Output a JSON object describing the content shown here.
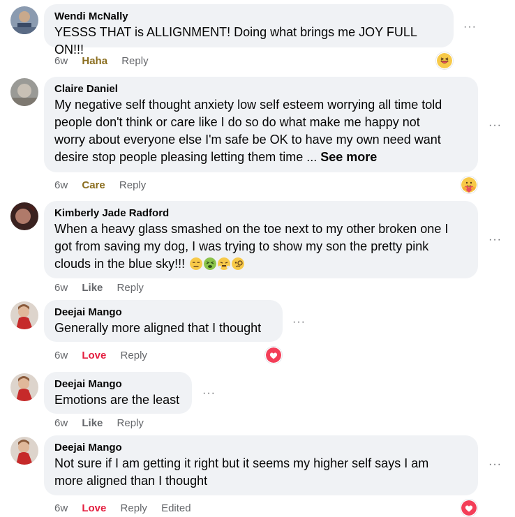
{
  "comments": [
    {
      "author": "Wendi McNally",
      "text": "YESSS THAT is ALLIGNMENT! Doing what brings me JOY FULL ON!!!",
      "time": "6w",
      "reaction": "Haha",
      "reply": "Reply",
      "reaction_icon": "haha-emoji-icon"
    },
    {
      "author": "Claire Daniel",
      "text_lines": [
        "My negative self thought anxiety low self esteem worrying all time told",
        "people don't think or care like I do so do what make me happy not",
        "worry about everyone else I'm safe be OK to have my own need want",
        "desire stop people pleasing letting them time ... "
      ],
      "see_more": "See more",
      "time": "6w",
      "reaction": "Care",
      "reply": "Reply",
      "reaction_icon": "care-emoji-icon"
    },
    {
      "author": "Kimberly Jade Radford",
      "text_lines": [
        "When a heavy glass smashed on the toe next to my other broken one I",
        "got from saving my dog, I was trying to show my son the pretty pink",
        "clouds in the blue sky!!! "
      ],
      "inline_emojis": [
        "expressionless-face-icon",
        "nauseated-face-icon",
        "steam-face-icon",
        "monocle-face-icon"
      ],
      "time": "6w",
      "reaction": "Like",
      "reply": "Reply"
    },
    {
      "author": "Deejai Mango",
      "text": "Generally more aligned that I thought",
      "time": "6w",
      "reaction": "Love",
      "reply": "Reply",
      "reaction_icon": "love-heart-icon"
    },
    {
      "author": "Deejai Mango",
      "text": "Emotions are the least",
      "time": "6w",
      "reaction": "Like",
      "reply": "Reply"
    },
    {
      "author": "Deejai Mango",
      "text_lines": [
        "Not sure if I am getting it right but it seems my higher self says I am",
        "more aligned than I thought"
      ],
      "time": "6w",
      "reaction": "Love",
      "reply": "Reply",
      "edited": "Edited",
      "reaction_icon": "love-heart-icon"
    }
  ],
  "more_glyph": "···",
  "colors": {
    "bubble": "#f0f2f5",
    "meta_text": "#65676b",
    "love": "#e41e3f",
    "haha_care": "#8b6e1f"
  }
}
